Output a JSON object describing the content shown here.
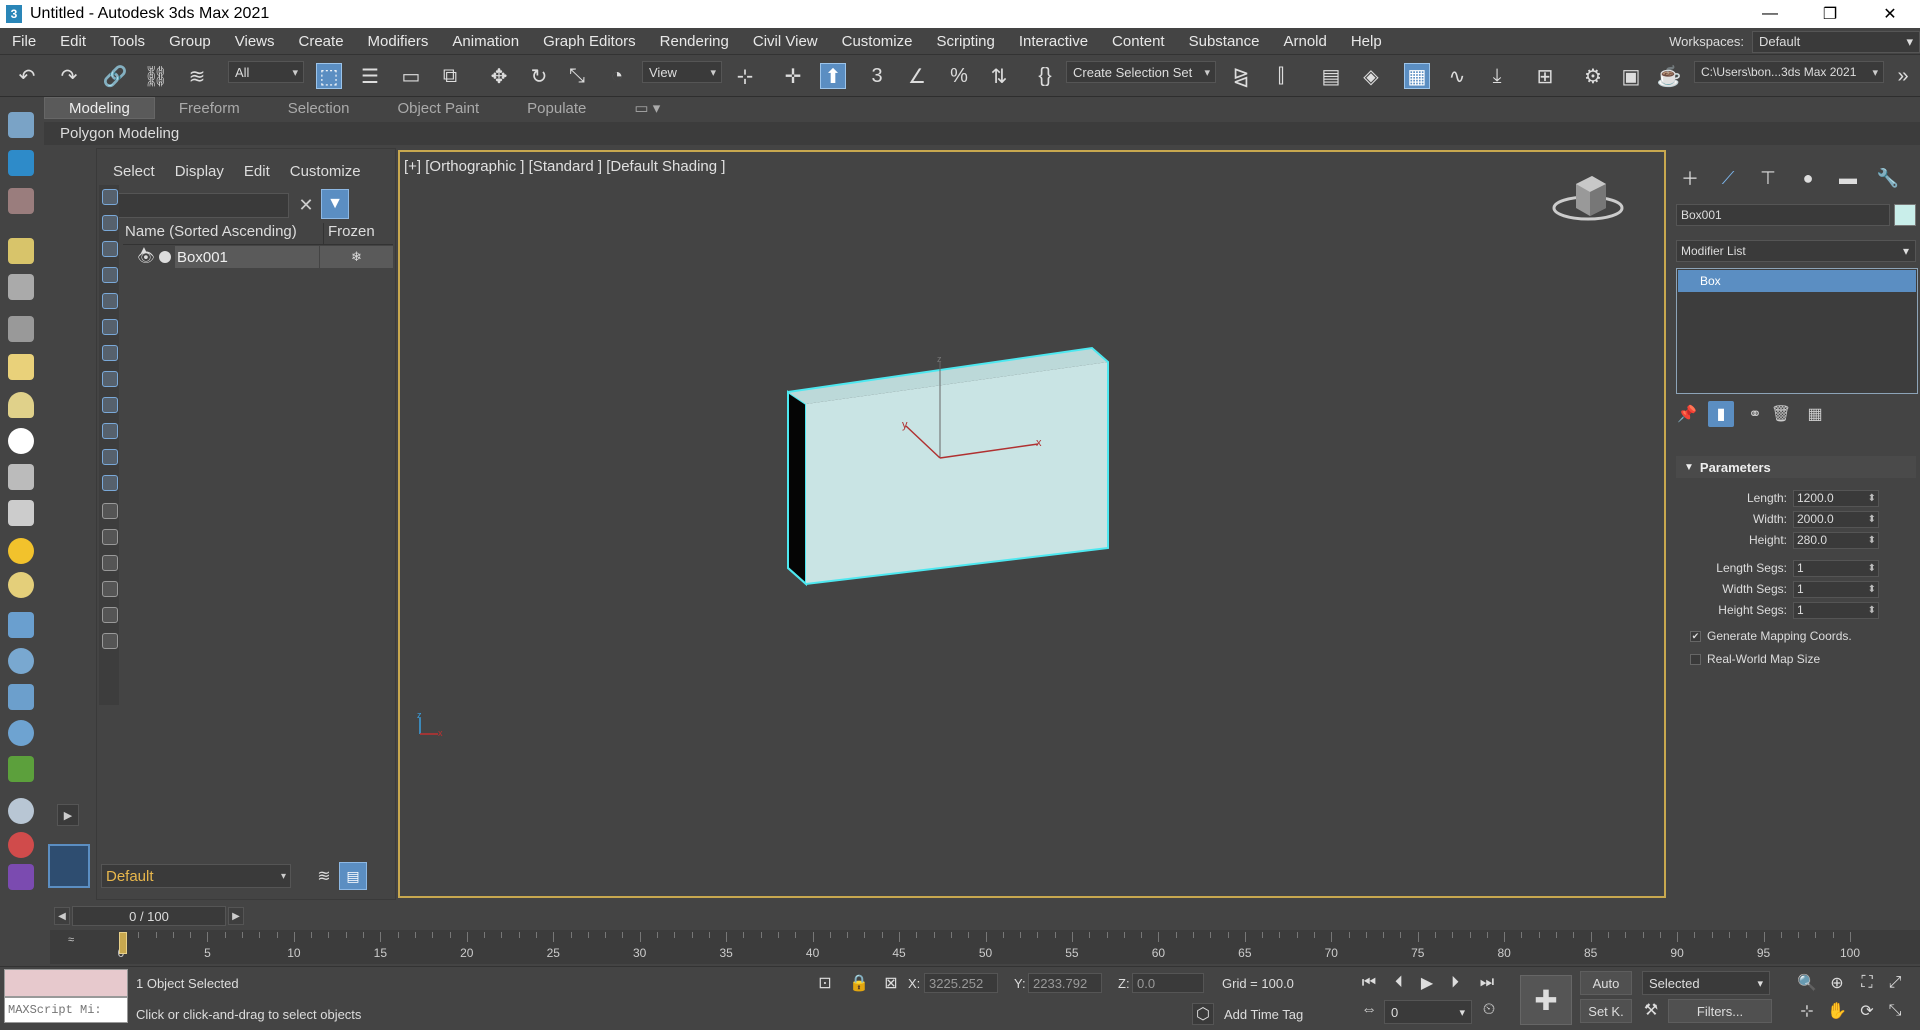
{
  "window": {
    "title": "Untitled - Autodesk 3ds Max 2021",
    "logo": "3"
  },
  "menu": [
    "File",
    "Edit",
    "Tools",
    "Group",
    "Views",
    "Create",
    "Modifiers",
    "Animation",
    "Graph Editors",
    "Rendering",
    "Civil View",
    "Customize",
    "Scripting",
    "Interactive",
    "Content",
    "Substance",
    "Arnold",
    "Help"
  ],
  "workspaces": {
    "label": "Workspaces:",
    "value": "Default"
  },
  "toolbar": {
    "filter_value": "All",
    "ref_coord_value": "View",
    "selection_set_value": "Create Selection Set",
    "project_path": "C:\\Users\\bon...3ds Max 2021"
  },
  "ribbon": {
    "tabs": [
      "Modeling",
      "Freeform",
      "Selection",
      "Object Paint",
      "Populate"
    ],
    "active_tab": "Modeling",
    "subpanel": "Polygon Modeling"
  },
  "explorer": {
    "menu": [
      "Select",
      "Display",
      "Edit",
      "Customize"
    ],
    "search_value": "",
    "col_name": "Name (Sorted Ascending)",
    "col_frozen": "Frozen",
    "sort_arrow": "▲",
    "rows": [
      {
        "name": "Box001"
      }
    ],
    "layer": "Default"
  },
  "viewport": {
    "label": "[+] [Orthographic ] [Standard ] [Default Shading ]",
    "axis_x": "x",
    "axis_y": "y",
    "axis_z": "z",
    "object_color": "#c9e4e4",
    "selection_color": "#4de8f0",
    "border_color": "#c8a84f"
  },
  "command_panel": {
    "object_name": "Box001",
    "object_swatch_color": "#c9eeea",
    "modifier_list": "Modifier List",
    "stack": [
      "Box"
    ],
    "rollout": "Parameters",
    "params": [
      {
        "label": "Length:",
        "value": "1200.0"
      },
      {
        "label": "Width:",
        "value": "2000.0"
      },
      {
        "label": "Height:",
        "value": "280.0"
      },
      {
        "label": "Length Segs:",
        "value": "1"
      },
      {
        "label": "Width Segs:",
        "value": "1"
      },
      {
        "label": "Height Segs:",
        "value": "1"
      }
    ],
    "checkboxes": [
      {
        "label": "Generate Mapping Coords.",
        "checked": true
      },
      {
        "label": "Real-World Map Size",
        "checked": false
      }
    ]
  },
  "timeline": {
    "frame_display": "0 / 100",
    "tick_labels": [
      "0",
      "5",
      "10",
      "15",
      "20",
      "25",
      "30",
      "35",
      "40",
      "45",
      "50",
      "55",
      "60",
      "65",
      "70",
      "75",
      "80",
      "85",
      "90",
      "95",
      "100"
    ]
  },
  "status": {
    "maxscript_placeholder": "MAXScript Mi:",
    "selection_text": "1 Object Selected",
    "prompt_text": "Click or click-and-drag to select objects",
    "x_label": "X:",
    "x_value": "3225.252",
    "y_label": "Y:",
    "y_value": "2233.792",
    "z_label": "Z:",
    "z_value": "0.0",
    "grid": "Grid = 100.0",
    "add_time_tag": "Add Time Tag",
    "auto_label": "Auto",
    "setkey_label": "Set K.",
    "key_filter_dd": "Selected",
    "filters_label": "Filters...",
    "current_frame": "0"
  }
}
